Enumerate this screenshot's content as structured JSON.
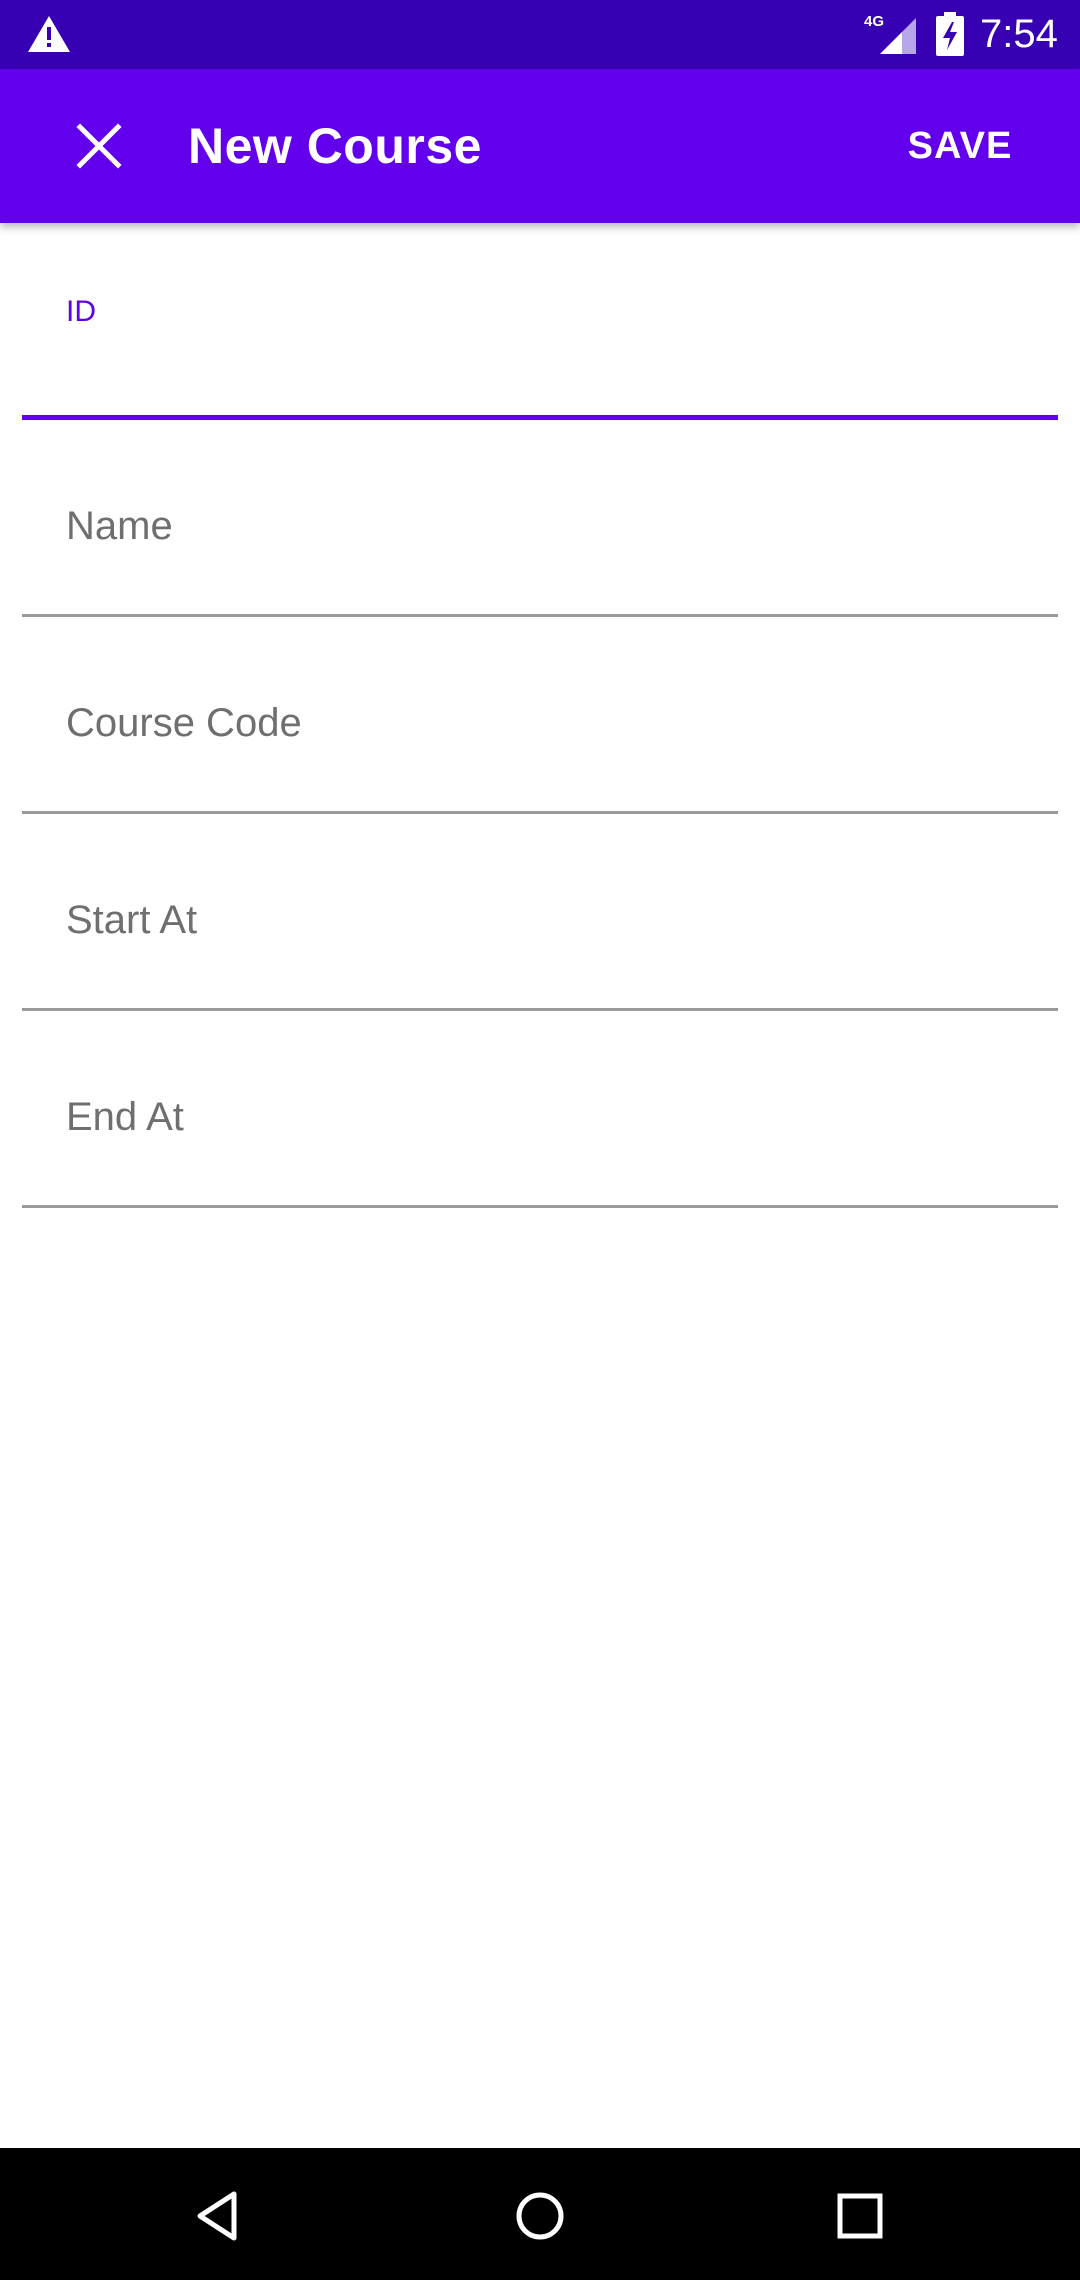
{
  "status_bar": {
    "network": "4G",
    "time": "7:54",
    "icons": [
      "warning-icon",
      "signal-icon",
      "battery-charging-icon"
    ]
  },
  "app_bar": {
    "close_icon": "close-icon",
    "title": "New Course",
    "save_label": "SAVE",
    "color": "#6200ee"
  },
  "form": {
    "fields": [
      {
        "label": "ID",
        "value": "",
        "focused": true
      },
      {
        "label": "Name",
        "value": ""
      },
      {
        "label": "Course Code",
        "value": ""
      },
      {
        "label": "Start At",
        "value": ""
      },
      {
        "label": "End At",
        "value": ""
      }
    ]
  },
  "nav_bar": {
    "icons": [
      "back-icon",
      "home-icon",
      "recents-icon"
    ]
  },
  "colors": {
    "status_bar": "#3700b3",
    "primary": "#6200ee",
    "hint_text": "#6f6f6f",
    "divider": "#9a9a9a"
  }
}
